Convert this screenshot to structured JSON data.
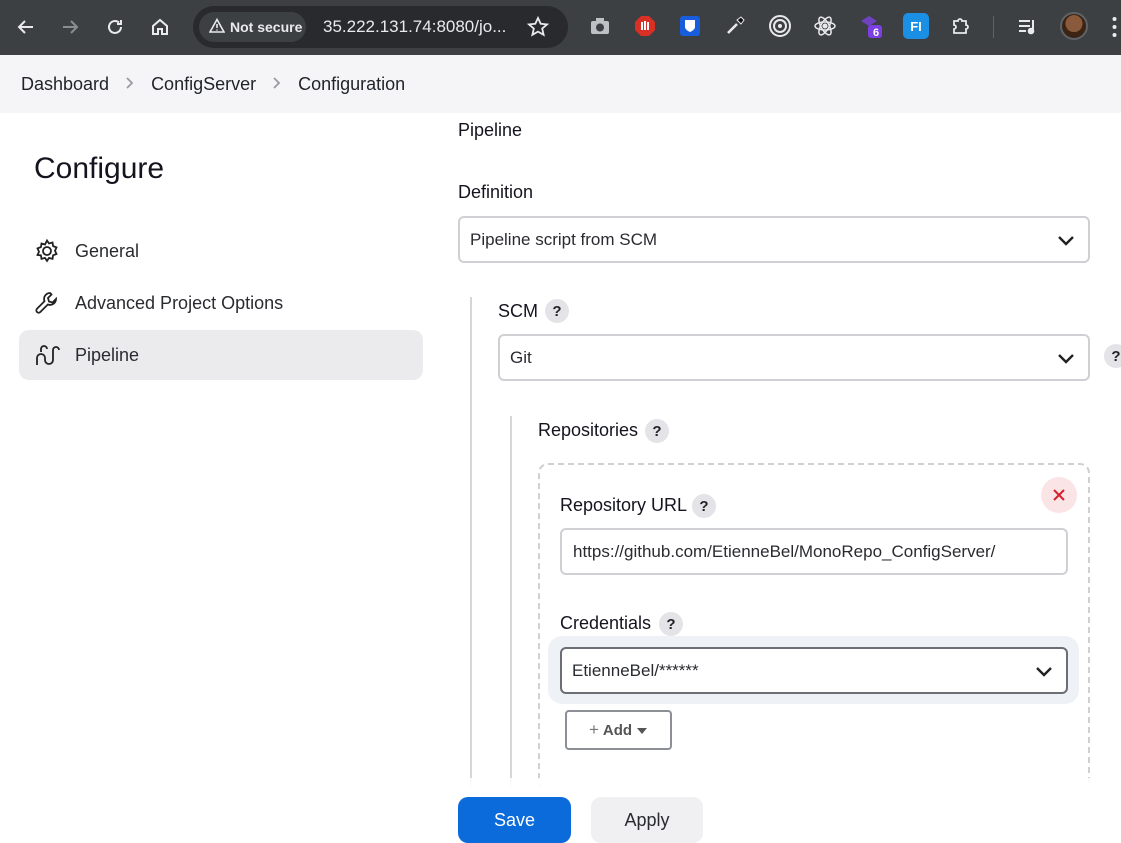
{
  "browser": {
    "security_label": "Not secure",
    "url": "35.222.131.74:8080/jo...",
    "extension_badge": "6",
    "extension_fi": "FI"
  },
  "breadcrumb": {
    "items": [
      "Dashboard",
      "ConfigServer",
      "Configuration"
    ]
  },
  "sidebar": {
    "title": "Configure",
    "items": [
      {
        "label": "General",
        "icon": "gear-icon"
      },
      {
        "label": "Advanced Project Options",
        "icon": "wrench-icon"
      },
      {
        "label": "Pipeline",
        "icon": "pipeline-icon"
      }
    ],
    "active": "Pipeline"
  },
  "pipeline": {
    "section_title": "Pipeline",
    "definition_label": "Definition",
    "definition_value": "Pipeline script from SCM",
    "scm_label": "SCM",
    "scm_value": "Git",
    "help_glyph": "?",
    "repositories_label": "Repositories",
    "repository_url_label": "Repository URL",
    "repository_url_value": "https://github.com/EtienneBel/MonoRepo_ConfigServer/",
    "credentials_label": "Credentials",
    "credentials_value": "EtienneBel/******",
    "add_label": "Add"
  },
  "footer": {
    "save_label": "Save",
    "apply_label": "Apply"
  },
  "colors": {
    "accent": "#0b6bdb",
    "danger": "#d3212d",
    "chrome": "#3c4043"
  }
}
